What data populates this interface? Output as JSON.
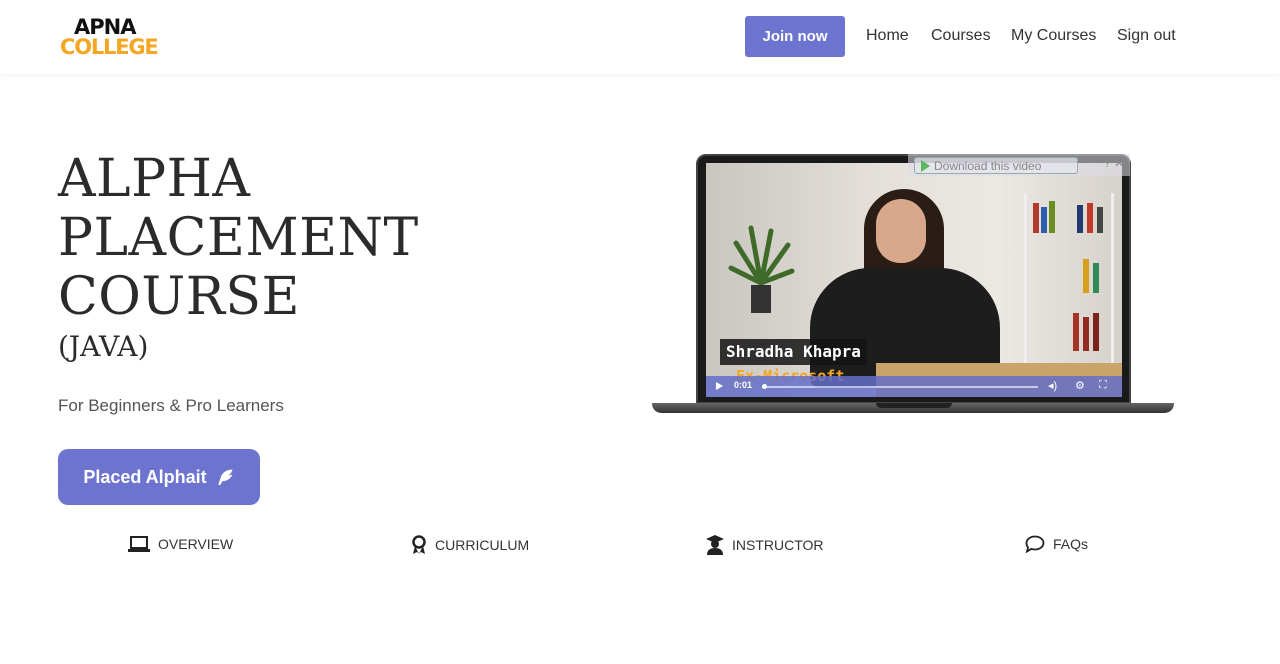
{
  "header": {
    "logo_line1": "APNA",
    "logo_line2": "COLLEGE",
    "join_label": "Join now",
    "nav": [
      "Home",
      "Courses",
      "My Courses",
      "Sign out"
    ]
  },
  "hero": {
    "title_lines": [
      "ALPHA",
      "PLACEMENT",
      "COURSE"
    ],
    "subtitle": "(JAVA)",
    "tagline": "For Beginners & Pro Learners",
    "cta_label": "Placed Alphait"
  },
  "video": {
    "download_label": "Download this video",
    "name": "Shradha Khapra",
    "role": "Ex-Microsoft",
    "time": "0:01"
  },
  "tabs": [
    "OVERVIEW",
    "CURRICULUM",
    "INSTRUCTOR",
    "FAQs"
  ],
  "colors": {
    "accent": "#6c74d0",
    "logo_orange": "#f5a623"
  }
}
